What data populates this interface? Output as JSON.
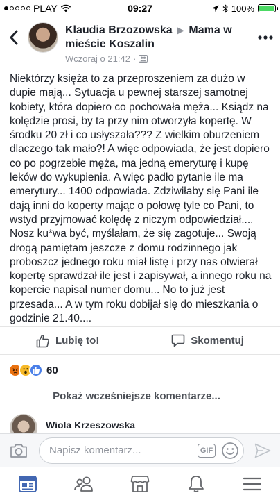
{
  "status_bar": {
    "carrier": "PLAY",
    "time": "09:27",
    "battery": "100%",
    "battery_level": 1.0
  },
  "header": {
    "author": "Klaudia Brzozowska",
    "group": "Mama w mieście Koszalin",
    "timestamp": "Wczoraj o 21:42",
    "privacy_icon": "group-icon"
  },
  "post": {
    "text": "Niektórzy księża to za przeproszeniem za dużo w dupie mają...  Sytuacja u pewnej starszej samotnej kobiety,  która dopiero co pochowała męża...  Ksiądz na kolędzie prosi, by ta przy nim otworzyła kopertę. W środku 20 zł i co usłyszała???  Z wielkim oburzeniem dlaczego tak mało?!  A więc odpowiada, że jest dopiero co po pogrzebie męża,  ma jedną emeryturę i kupę leków do wykupienia. A więc padło pytanie ile ma emerytury...  1400 odpowiada. Zdziwiłaby się Pani ile dają inni do koperty mając o połowę tyle co Pani,  to wstyd przyjmować kolędę z niczym odpowiedział....  Nosz ku*wa być, myślałam, że się zagotuje...  Swoją drogą pamiętam jeszcze z domu rodzinnego jak proboszcz jednego roku miał listę i przy nas otwierał kopertę sprawdzał ile jest i zapisywał, a innego roku na kopercie napisał numer domu...  No to już jest przesada...  A w tym roku dobijał się do mieszkania o godzinie 21.40...."
  },
  "actions": {
    "like_label": "Lubię to!",
    "comment_label": "Skomentuj"
  },
  "reactions": {
    "count": "60",
    "types": [
      "angry",
      "wow",
      "like"
    ]
  },
  "comments": {
    "previous_label": "Pokaż wcześniejsze komentarze...",
    "first_author": "Wiola Krzeszowska"
  },
  "composer": {
    "placeholder": "Napisz komentarz...",
    "gif_label": "GIF"
  },
  "tabs": [
    "news-feed-icon",
    "friends-icon",
    "marketplace-icon",
    "notifications-icon",
    "menu-icon"
  ],
  "colors": {
    "text": "#1d2129",
    "secondary": "#90949c",
    "action": "#4b4f56",
    "active_tab": "#4267b2",
    "battery": "#4cd964"
  }
}
